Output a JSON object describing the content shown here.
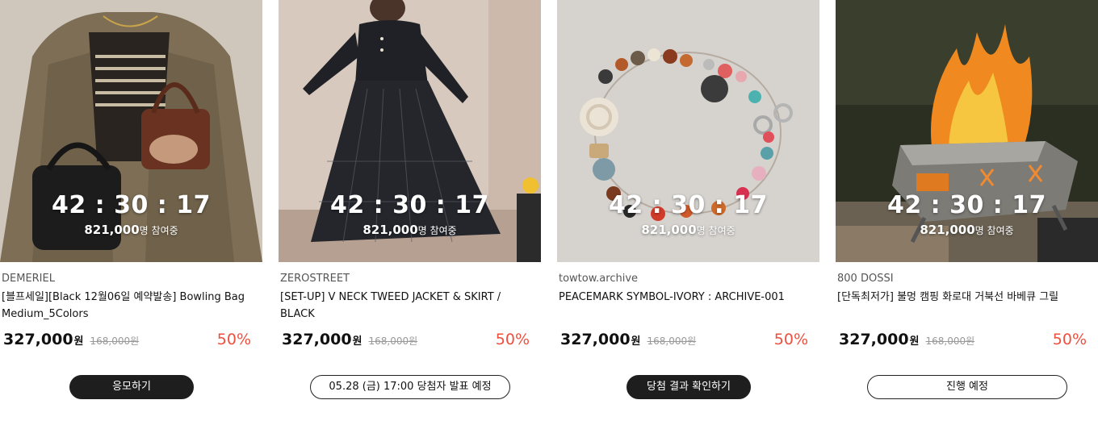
{
  "products": [
    {
      "brand": "DEMERIEL",
      "title": "[블프세일][Black 12월06일 예약발송] Bowling Bag Medium_5Colors",
      "timer": "42 : 30 : 17",
      "participants_count": "821,000",
      "participants_suffix": "명 참여중",
      "price": "327,000",
      "currency": "원",
      "original_price": "168,000원",
      "discount": "50%",
      "cta": "응모하기",
      "cta_style": "dark"
    },
    {
      "brand": "ZEROSTREET",
      "title": "[SET-UP] V NECK TWEED JACKET & SKIRT / BLACK",
      "timer": "42 : 30 : 17",
      "participants_count": "821,000",
      "participants_suffix": "명 참여중",
      "price": "327,000",
      "currency": "원",
      "original_price": "168,000원",
      "discount": "50%",
      "cta": "05.28 (금) 17:00 당첨자 발표 예정",
      "cta_style": "light"
    },
    {
      "brand": "towtow.archive",
      "title": "PEACEMARK SYMBOL-IVORY : ARCHIVE-001",
      "timer": "42 : 30 : 17",
      "participants_count": "821,000",
      "participants_suffix": "명 참여중",
      "price": "327,000",
      "currency": "원",
      "original_price": "168,000원",
      "discount": "50%",
      "cta": "당첨 결과 확인하기",
      "cta_style": "dark"
    },
    {
      "brand": "800 DOSSI",
      "title": "[단독최저가] 불멍 캠핑 화로대 거북선 바베큐 그릴",
      "timer": "42 : 30 : 17",
      "participants_count": "821,000",
      "participants_suffix": "명 참여중",
      "price": "327,000",
      "currency": "원",
      "original_price": "168,000원",
      "discount": "50%",
      "cta": "진행 예정",
      "cta_style": "light"
    }
  ],
  "colors": {
    "discount": "#ee4f3e",
    "dark_button": "#1e1e1e",
    "brand_text": "#555555",
    "strike_price": "#999999"
  }
}
